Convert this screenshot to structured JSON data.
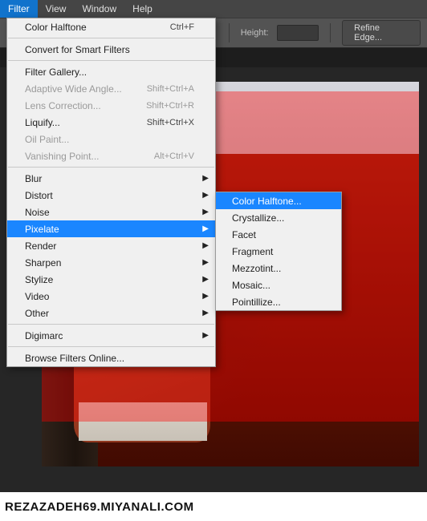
{
  "menubar": {
    "items": [
      "Filter",
      "View",
      "Window",
      "Help"
    ],
    "active_index": 0
  },
  "optionsbar": {
    "height_label": "Height:",
    "height_value": "",
    "refine_edge_label": "Refine Edge..."
  },
  "filter_menu": {
    "last_filter": {
      "label": "Color Halftone",
      "shortcut": "Ctrl+F",
      "enabled": true
    },
    "convert_smart": {
      "label": "Convert for Smart Filters",
      "enabled": true
    },
    "gallery": {
      "label": "Filter Gallery...",
      "enabled": true
    },
    "adaptive": {
      "label": "Adaptive Wide Angle...",
      "shortcut": "Shift+Ctrl+A",
      "enabled": false
    },
    "lens": {
      "label": "Lens Correction...",
      "shortcut": "Shift+Ctrl+R",
      "enabled": false
    },
    "liquify": {
      "label": "Liquify...",
      "shortcut": "Shift+Ctrl+X",
      "enabled": true
    },
    "oilpaint": {
      "label": "Oil Paint...",
      "enabled": false
    },
    "vanishing": {
      "label": "Vanishing Point...",
      "shortcut": "Alt+Ctrl+V",
      "enabled": false
    },
    "groups": [
      {
        "label": "Blur",
        "enabled": true
      },
      {
        "label": "Distort",
        "enabled": true
      },
      {
        "label": "Noise",
        "enabled": true
      },
      {
        "label": "Pixelate",
        "enabled": true,
        "highlight": true
      },
      {
        "label": "Render",
        "enabled": true
      },
      {
        "label": "Sharpen",
        "enabled": true
      },
      {
        "label": "Stylize",
        "enabled": true
      },
      {
        "label": "Video",
        "enabled": true
      },
      {
        "label": "Other",
        "enabled": true
      }
    ],
    "digimarc": {
      "label": "Digimarc",
      "enabled": true
    },
    "browse": {
      "label": "Browse Filters Online...",
      "enabled": true
    }
  },
  "pixelate_submenu": {
    "items": [
      {
        "label": "Color Halftone...",
        "highlight": true
      },
      {
        "label": "Crystallize..."
      },
      {
        "label": "Facet"
      },
      {
        "label": "Fragment"
      },
      {
        "label": "Mezzotint..."
      },
      {
        "label": "Mosaic..."
      },
      {
        "label": "Pointillize..."
      }
    ]
  },
  "watermark": "REZAZADEH69.MIYANALI.COM"
}
